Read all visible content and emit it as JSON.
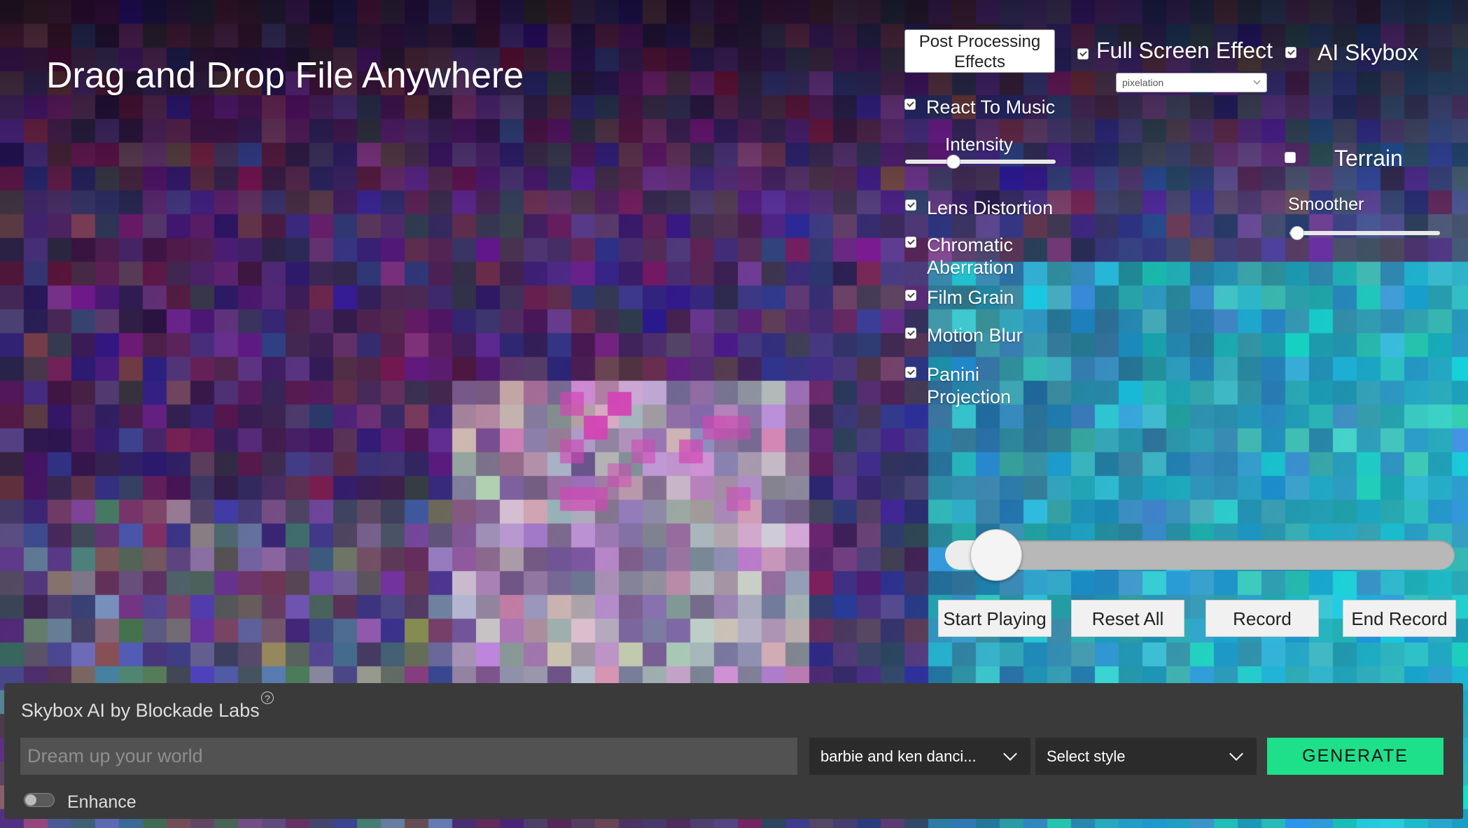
{
  "header": {
    "title": "Drag and Drop File Anywhere"
  },
  "effects": {
    "post_processing_button": "Post Processing Effects",
    "full_screen_effect": {
      "label": "Full Screen Effect",
      "checked": true
    },
    "effect_select": {
      "value": "pixelation"
    },
    "ai_skybox": {
      "label": "AI Skybox",
      "checked": true
    },
    "react_to_music": {
      "label": "React To Music",
      "checked": true
    },
    "intensity": {
      "label": "Intensity",
      "value": 0.32
    },
    "terrain": {
      "label": "Terrain",
      "checked": false
    },
    "smoother": {
      "label": "Smoother",
      "value": 0.05
    },
    "items": [
      {
        "label": "Lens Distortion",
        "checked": true
      },
      {
        "label": "Chromatic Aberration",
        "checked": true
      },
      {
        "label": "Film Grain",
        "checked": true
      },
      {
        "label": "Motion Blur",
        "checked": true
      },
      {
        "label": "Panini Projection",
        "checked": true
      }
    ]
  },
  "playback": {
    "position": 0.1
  },
  "actions": {
    "start_playing": "Start Playing",
    "reset_all": "Reset All",
    "record": "Record",
    "end_record": "End Record"
  },
  "skybox_panel": {
    "title": "Skybox AI by Blockade Labs",
    "help_icon": "?",
    "prompt_placeholder": "Dream up your world",
    "prompt_value": "",
    "preset_select": "barbie and ken danci...",
    "style_select": "Select style",
    "generate_label": "GENERATE",
    "enhance_label": "Enhance",
    "enhance_on": false
  }
}
